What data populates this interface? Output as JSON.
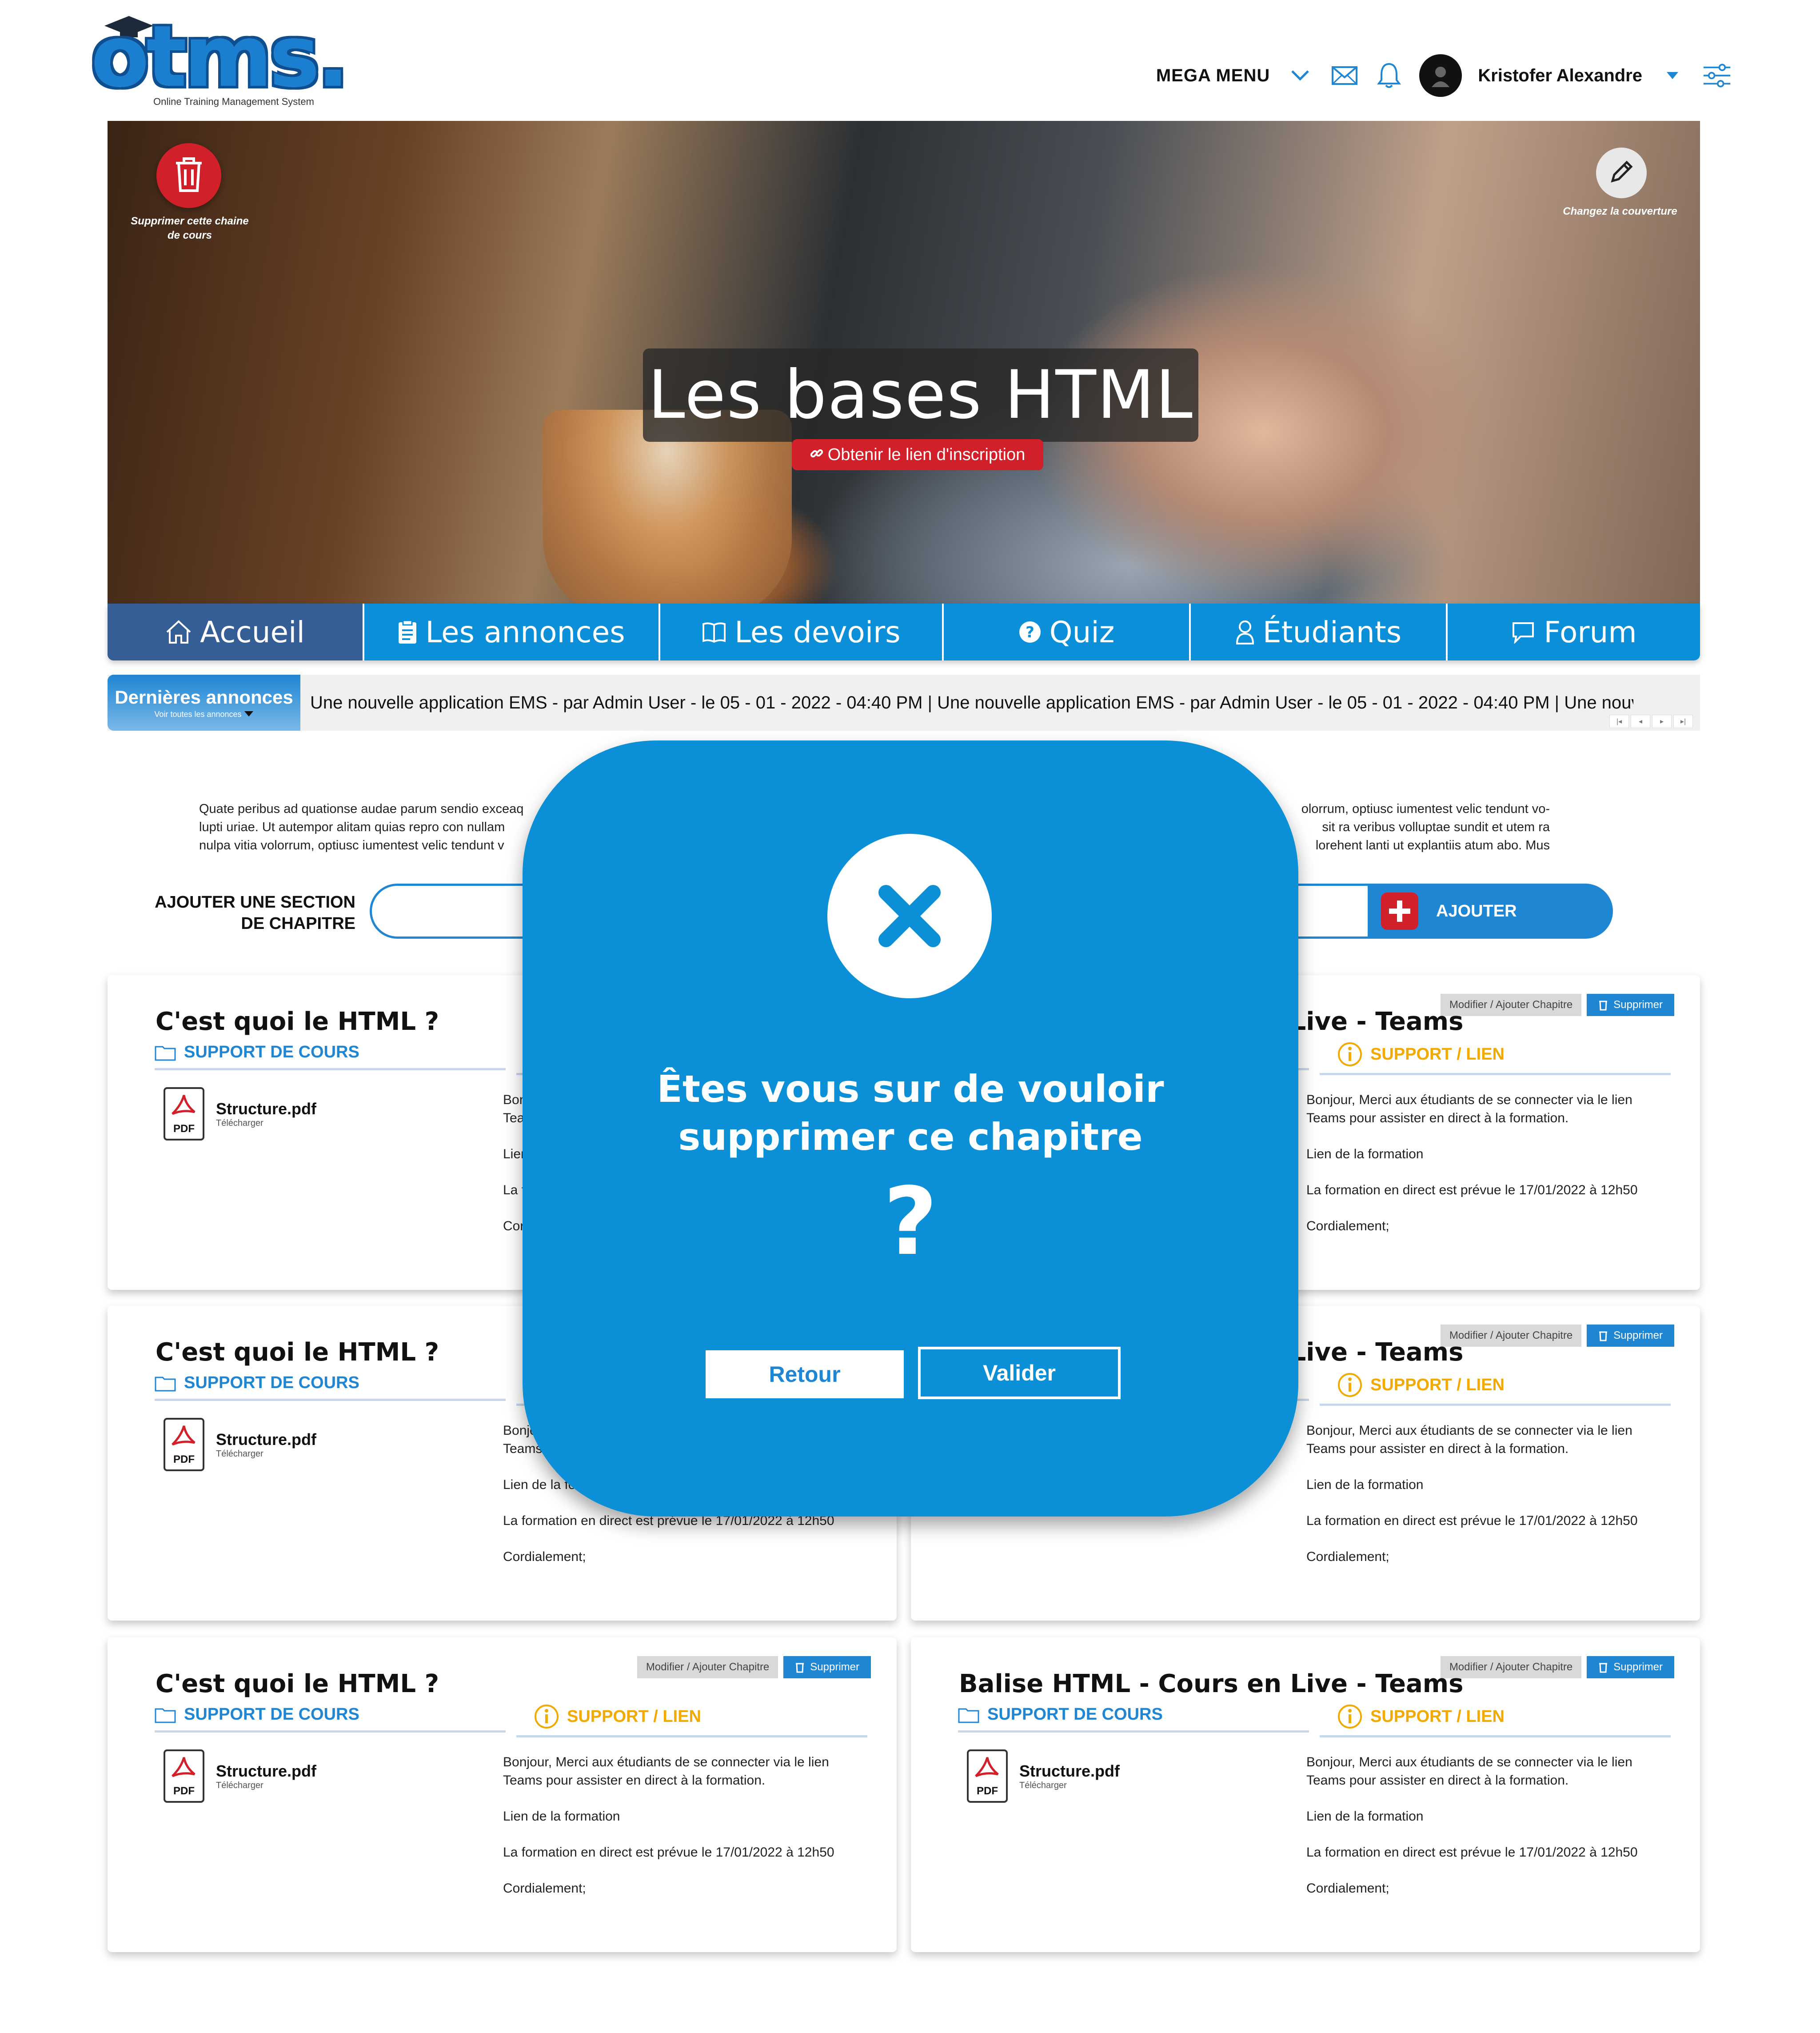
{
  "logo": {
    "text": "otms.",
    "tagline": "Online Training Management System"
  },
  "topnav": {
    "mega_menu": "MEGA MENU",
    "user_name": "Kristofer Alexandre"
  },
  "hero": {
    "title": "Les bases HTML",
    "delete_label": "Supprimer cette chaine de cours",
    "cover_label": "Changez la couverture",
    "registration_link": "Obtenir le lien d'inscription"
  },
  "tabs": [
    {
      "label": "Accueil",
      "icon": "home-icon"
    },
    {
      "label": "Les annonces",
      "icon": "clipboard-icon"
    },
    {
      "label": "Les devoirs",
      "icon": "book-icon"
    },
    {
      "label": "Quiz",
      "icon": "question-icon"
    },
    {
      "label": "Étudiants",
      "icon": "user-icon"
    },
    {
      "label": "Forum",
      "icon": "chat-icon"
    }
  ],
  "news": {
    "title": "Dernières annonces",
    "subtitle": "Voir toutes les annonces",
    "ticker": "Une nouvelle application EMS - par Admin User - le 05 - 01 - 2022 - 04:40 PM | Une nouvelle application EMS - par Admin User - le 05 - 01 - 2022 - 04:40 PM | Une nouvelle"
  },
  "intro": {
    "line1": "Quate peribus ad quationse audae parum sendio exceaq",
    "line1b": "olorrum, optiusc iumentest velic tendunt vo-",
    "line2": "lupti uriae. Ut autempor alitam quias repro con nullam",
    "line2b": "sit ra veribus volluptae sundit et utem ra",
    "line3": "nulpa vitia volorrum, optiusc iumentest velic tendunt v",
    "line3b": "lorehent lanti ut explantiis atum abo. Mus"
  },
  "add_section": {
    "label": "AJOUTER UNE SECTION DE CHAPITRE",
    "button": "AJOUTER"
  },
  "card_common": {
    "support_head": "SUPPORT DE COURS",
    "link_head": "SUPPORT / LIEN",
    "file_name": "Structure.pdf",
    "file_dl": "Télécharger",
    "pdf_label": "PDF",
    "modify": "Modifier / Ajouter Chapitre",
    "delete": "Supprimer",
    "body1": "Bonjour, Merci aux étudiants de se connecter via le lien Teams pour assister en direct à la formation.",
    "body2": "Lien de la formation",
    "body3": "La formation en direct est prévue le 17/01/2022 à 12h50",
    "body4": "Cordialement;"
  },
  "cards": [
    {
      "title": "C'est quoi le HTML ?"
    },
    {
      "title": "Balise HTML - Cours en Live - Teams"
    },
    {
      "title": "C'est quoi le HTML ?"
    },
    {
      "title": "Balise HTML - Cours en Live - Teams"
    },
    {
      "title": "C'est quoi le HTML ?"
    },
    {
      "title": "Balise HTML - Cours en Live - Teams"
    }
  ],
  "modal": {
    "message_line1": "Êtes vous sur de vouloir",
    "message_line2": "supprimer ce chapitre",
    "question_mark": "?",
    "back": "Retour",
    "confirm": "Valider"
  },
  "colors": {
    "primary": "#1f86d4",
    "accent_red": "#d2202a",
    "link_orange": "#f2a900",
    "active_tab": "#355d96"
  }
}
